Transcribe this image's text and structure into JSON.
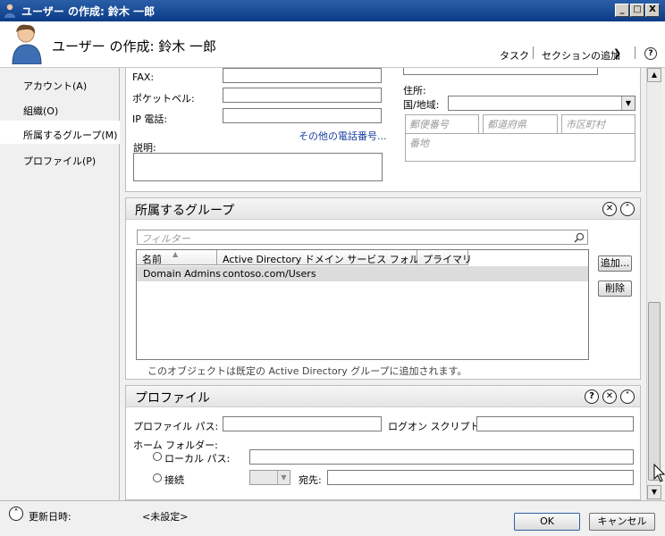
{
  "window": {
    "title": "ユーザー の作成: 鈴木 一郎",
    "controls": [
      "_",
      "□",
      "X"
    ]
  },
  "header": {
    "title": "ユーザー の作成: 鈴木 一郎",
    "tasks_label": "タスク",
    "add_section_label": "セクションの追加",
    "help_glyph": "?"
  },
  "sidebar": {
    "items": [
      {
        "label": "アカウント(A)",
        "selected": false
      },
      {
        "label": "組織(O)",
        "selected": false
      },
      {
        "label": "所属するグループ(M)",
        "selected": true
      },
      {
        "label": "プロファイル(P)",
        "selected": false
      }
    ]
  },
  "org_section": {
    "fax_label": "FAX:",
    "pager_label": "ポケットベル:",
    "ip_phone_label": "IP 電話:",
    "other_phones_link": "その他の電話番号...",
    "description_label": "説明:",
    "address_label": "住所:",
    "country_label": "国/地域:",
    "postal_placeholder": "郵便番号",
    "prefecture_placeholder": "都道府県",
    "city_placeholder": "市区町村",
    "street_placeholder": "番地"
  },
  "groups_section": {
    "title": "所属するグループ",
    "filter_placeholder": "フィルター",
    "columns": [
      "名前",
      "Active Directory ドメイン サービス フォルダー",
      "プライマリ"
    ],
    "rows": [
      {
        "name": "Domain Admins",
        "folder": "contoso.com/Users",
        "primary": ""
      }
    ],
    "add_button": "追加...",
    "remove_button": "削除",
    "note": "このオブジェクトは既定の Active Directory グループに追加されます。"
  },
  "profile_section": {
    "title": "プロファイル",
    "profile_path_label": "プロファイル パス:",
    "logon_script_label": "ログオン スクリプト:",
    "home_folder_label": "ホーム フォルダー:",
    "local_path_label": "ローカル パス:",
    "connect_label": "接続",
    "to_label": "宛先:"
  },
  "footer": {
    "modified_label": "更新日時:",
    "modified_value": "<未設定>",
    "ok_button": "OK",
    "cancel_button": "キャンセル"
  }
}
